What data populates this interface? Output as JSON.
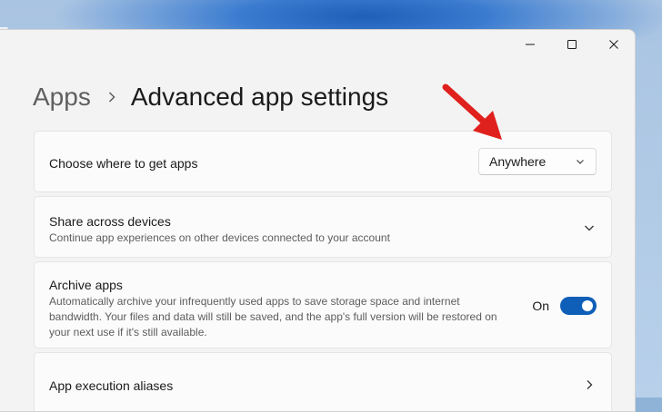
{
  "breadcrumb": {
    "parent": "Apps",
    "current": "Advanced app settings"
  },
  "window_controls": [
    "minimize-icon",
    "maximize-icon",
    "close-icon"
  ],
  "settings": {
    "get_apps": {
      "title": "Choose where to get apps",
      "selected": "Anywhere"
    },
    "share": {
      "title": "Share across devices",
      "description": "Continue app experiences on other devices connected to your account"
    },
    "archive": {
      "title": "Archive apps",
      "description_lines": [
        "Automatically archive your infrequently used apps to save storage space and internet",
        "bandwidth. Your files and data will still be saved, and the app's full version will be restored on",
        "your next use if it's still available."
      ],
      "toggle_label": "On",
      "toggle_state": true
    },
    "aliases": {
      "title": "App execution aliases"
    }
  },
  "colors": {
    "accent": "#0f5fb8",
    "annotation_arrow": "#e0201c"
  }
}
